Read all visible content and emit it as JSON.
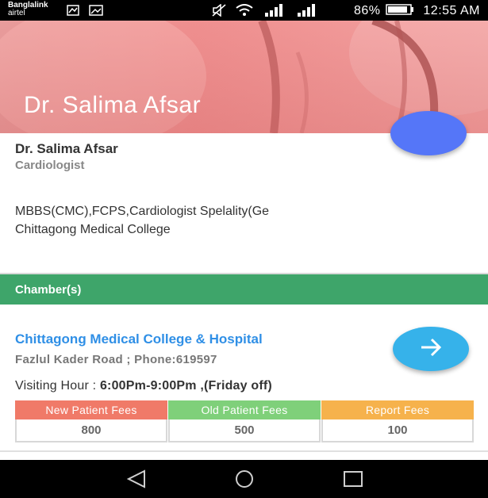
{
  "status_bar": {
    "carrier_1": "Banglalink",
    "carrier_2": "airtel",
    "battery": "86%",
    "time": "12:55 AM"
  },
  "header": {
    "title": "Dr. Salima Afsar"
  },
  "doctor": {
    "name": "Dr. Salima Afsar",
    "specialty": "Cardiologist",
    "qualifications": "MBBS(CMC),FCPS,Cardiologist Spelality(Ge",
    "college": "Chittagong Medical College"
  },
  "chambers": {
    "section_title": "Chamber(s)",
    "items": [
      {
        "name": "Chittagong Medical College & Hospital",
        "address": "Fazlul Kader Road ; Phone:619597",
        "visiting_label": "Visiting Hour : ",
        "visiting_value": "6:00Pm-9:00Pm ,(Friday off)",
        "fees": [
          {
            "label": "New Patient Fees",
            "value": "800",
            "color": "#f07a68"
          },
          {
            "label": "Old Patient Fees",
            "value": "500",
            "color": "#7fd07a"
          },
          {
            "label": "Report Fees",
            "value": "100",
            "color": "#f6b24c"
          }
        ]
      }
    ]
  },
  "colors": {
    "header": "#ef8f8f",
    "fab_blue": "#5576f8",
    "chamber_bar": "#3ea56a",
    "link_blue": "#2f8fe6",
    "arrow_fab": "#36b2ea"
  },
  "icons": {
    "status": [
      "wifi-icon",
      "signal-icon",
      "battery-icon",
      "mute-icon"
    ],
    "nav": [
      "back-icon",
      "home-icon",
      "recents-icon"
    ],
    "chamber": "arrow-right-icon"
  }
}
